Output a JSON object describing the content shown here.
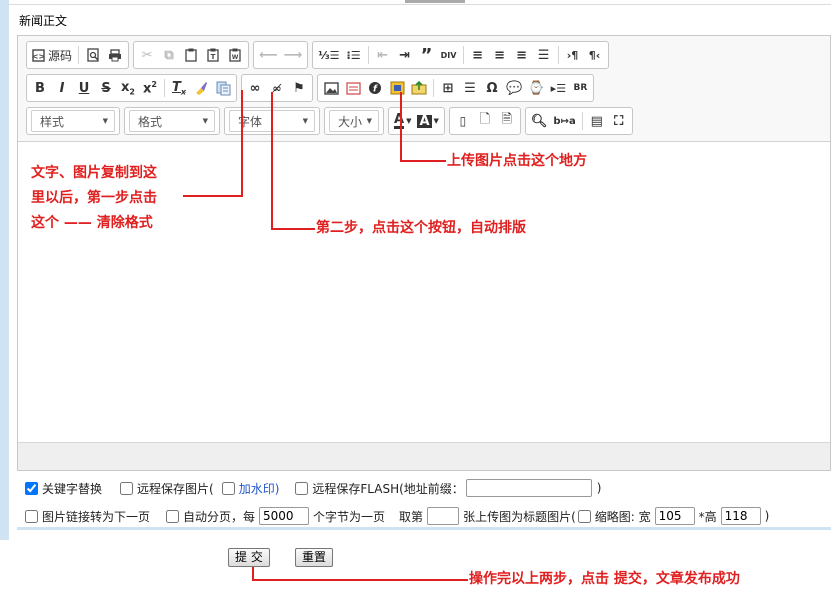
{
  "field_label": "新闻正文",
  "toolbar": {
    "source_label": "源码",
    "combos": {
      "styles": "样式",
      "format": "格式",
      "font": "字体",
      "size": "大小"
    }
  },
  "annotations": {
    "upload_tip": "上传图片点击这个地方",
    "step1_line1": "文字、图片复制到这",
    "step1_line2": "里以后，第一步点击",
    "step1_line3": "这个 —— 清除格式",
    "step2_tip": "第二步，点击这个按钮，自动排版",
    "submit_tip": "操作完以上两步，点击 提交，文章发布成功"
  },
  "options": {
    "keyword_replace": "关键字替换",
    "remote_save_images": "远程保存图片(",
    "watermark": "加水印)",
    "remote_save_flash": "远程保存FLASH(地址前缀：",
    "flash_prefix_value": "",
    "close_paren": ")",
    "link_next_page": "图片链接转为下一页",
    "auto_paging": "自动分页，每",
    "chars_per_page": "5000",
    "chars_per_page_suffix": "个字节为一页",
    "take_nth_prefix": "取第",
    "take_nth_value": "",
    "take_nth_suffix": "张上传图为标题图片(",
    "thumbnail_label": "缩略图: 宽",
    "thumb_width": "105",
    "height_label": "*高",
    "thumb_height": "118",
    "close_paren2": ")"
  },
  "actions": {
    "submit": "提 交",
    "reset": "重置"
  }
}
